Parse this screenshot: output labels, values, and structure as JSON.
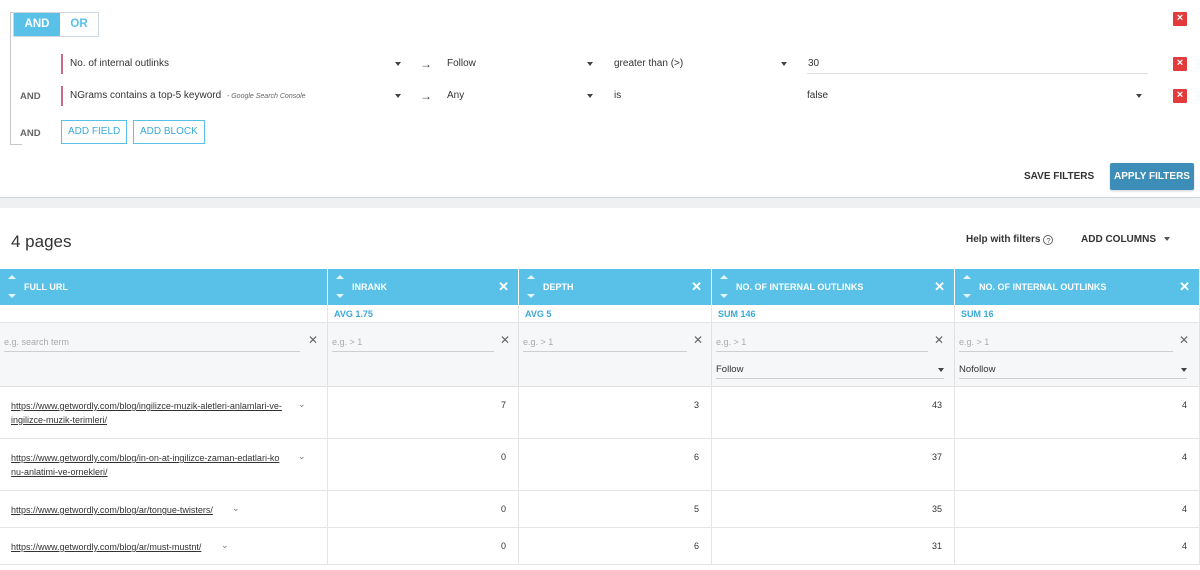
{
  "filters": {
    "logic_options": [
      "AND",
      "OR"
    ],
    "active_logic": "AND",
    "rows": [
      {
        "connector": "",
        "field": "No. of internal outlinks",
        "field_source": "",
        "link_type": "Follow",
        "operator": "greater than (>)",
        "value": "30"
      },
      {
        "connector": "AND",
        "field": "NGrams contains a top-5 keyword",
        "field_source": "- Google Search Console",
        "link_type": "Any",
        "operator": "is",
        "value": "false"
      }
    ],
    "add_connector": "AND",
    "add_field_label": "ADD FIELD",
    "add_block_label": "ADD BLOCK",
    "save_label": "SAVE FILTERS",
    "apply_label": "APPLY FILTERS",
    "delete_glyph": "×",
    "arrow_glyph": "→"
  },
  "results": {
    "count_label": "4 pages",
    "help_label": "Help with filters",
    "help_glyph": "?",
    "add_columns_label": "ADD COLUMNS",
    "columns": [
      {
        "label": "FULL URL",
        "closable": false,
        "agg": "",
        "filter_placeholder": "e.g. search term",
        "dropdown": ""
      },
      {
        "label": "INRANK",
        "closable": true,
        "agg": "AVG  1.75",
        "filter_placeholder": "e.g. > 1",
        "dropdown": ""
      },
      {
        "label": "DEPTH",
        "closable": true,
        "agg": "AVG  5",
        "filter_placeholder": "e.g. > 1",
        "dropdown": ""
      },
      {
        "label": "NO. OF INTERNAL OUTLINKS",
        "closable": true,
        "agg": "SUM  146",
        "filter_placeholder": "e.g. > 1",
        "dropdown": "Follow"
      },
      {
        "label": "NO. OF INTERNAL OUTLINKS",
        "closable": true,
        "agg": "SUM  16",
        "filter_placeholder": "e.g. > 1",
        "dropdown": "Nofollow"
      }
    ],
    "close_glyph": "✕",
    "rows": [
      {
        "url_line1": "https://www.getwordly.com/blog/ingilizce-muzik-aletleri-anlamlari-ve-",
        "url_line2": "ingilizce-muzik-terimleri/",
        "inrank": "7",
        "depth": "3",
        "follow": "43",
        "nofollow": "4"
      },
      {
        "url_line1": "https://www.getwordly.com/blog/in-on-at-ingilizce-zaman-edatlari-ko",
        "url_line2": "nu-anlatimi-ve-ornekleri/",
        "inrank": "0",
        "depth": "6",
        "follow": "37",
        "nofollow": "4"
      },
      {
        "url_line1": "https://www.getwordly.com/blog/ar/tongue-twisters/",
        "url_line2": "",
        "inrank": "0",
        "depth": "5",
        "follow": "35",
        "nofollow": "4"
      },
      {
        "url_line1": "https://www.getwordly.com/blog/ar/must-mustnt/",
        "url_line2": "",
        "inrank": "0",
        "depth": "6",
        "follow": "31",
        "nofollow": "4"
      }
    ],
    "chevron_glyph": "⌄"
  },
  "colors": {
    "accent": "#59c1e8",
    "apply_bg": "#3c8eb8",
    "delete": "#e33b3b",
    "field_marker": "#c56d86"
  }
}
